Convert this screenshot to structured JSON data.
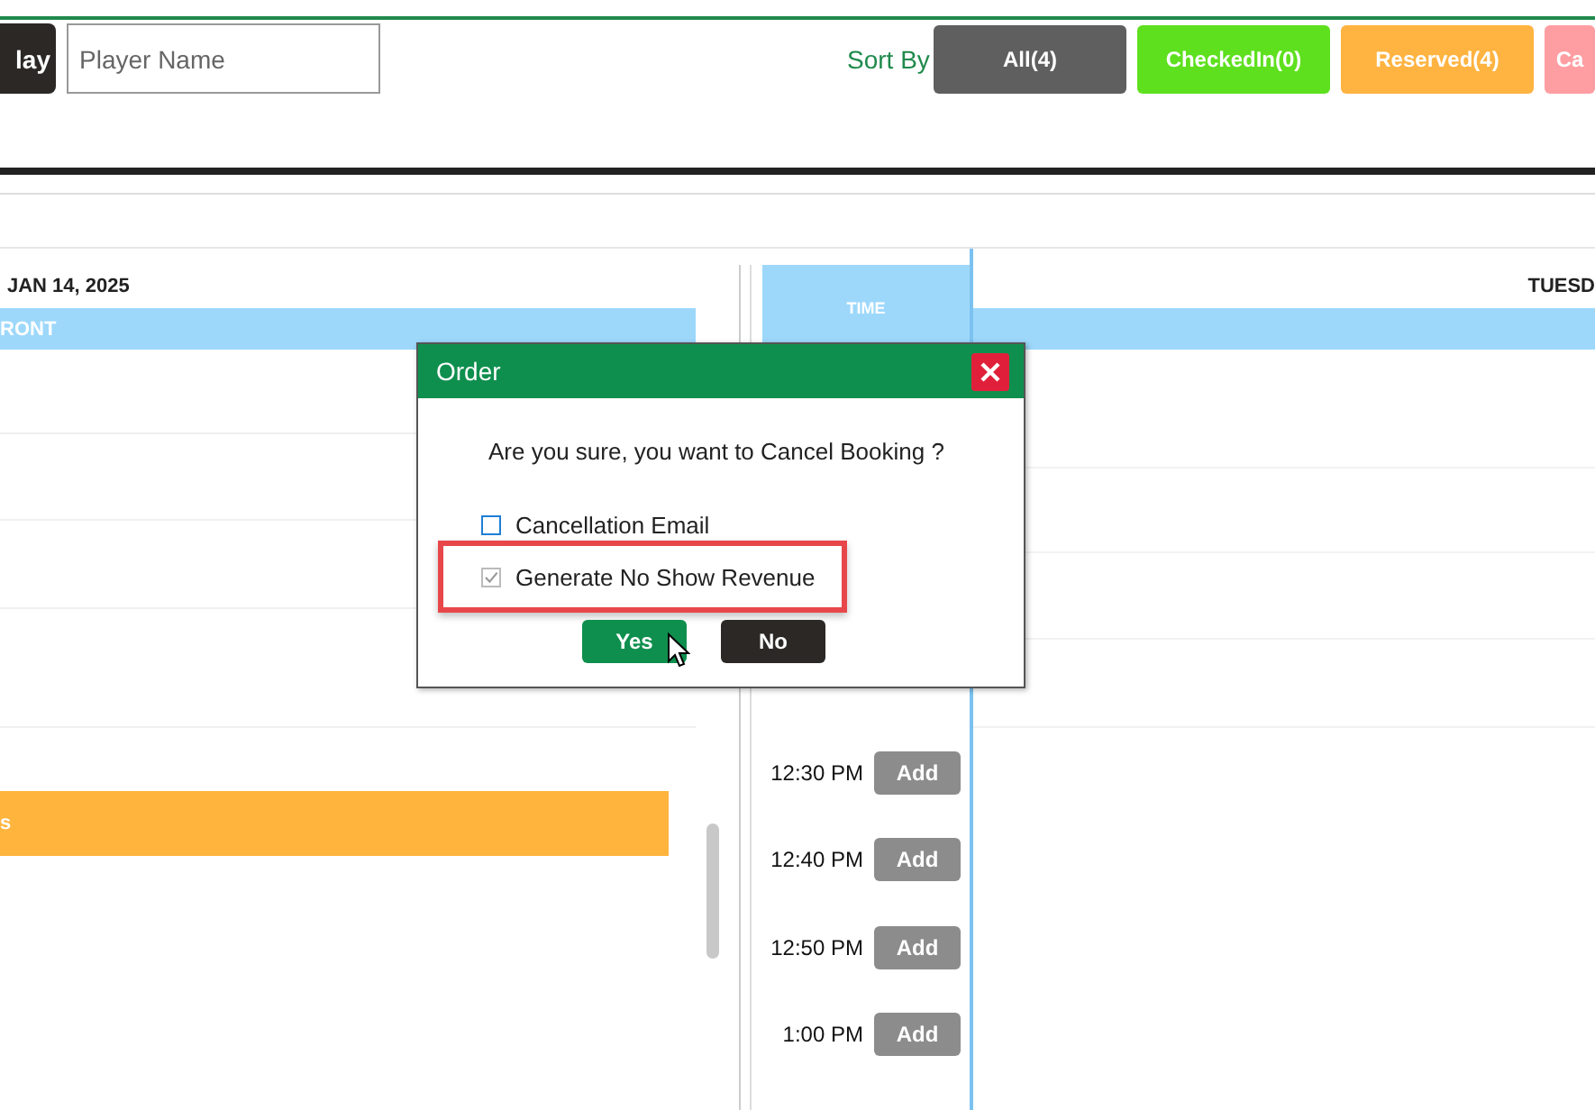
{
  "toolbar": {
    "day_button": "lay",
    "player_search": {
      "placeholder": "Player Name"
    },
    "sort_label": "Sort By",
    "filters": [
      {
        "label": "All(4)",
        "color": "#5f5f5f"
      },
      {
        "label": "CheckedIn(0)",
        "color": "#5ee01e"
      },
      {
        "label": "Reserved(4)",
        "color": "#ffb340"
      },
      {
        "label": "Ca",
        "color": "#ff9ea2"
      }
    ]
  },
  "left_day": {
    "date": "JAN 14, 2025",
    "lane": "RONT",
    "booking": {
      "label": "s"
    }
  },
  "right_day": {
    "time_header": "TIME",
    "date": "TUESD",
    "slots": [
      {
        "time": "12:30 PM",
        "action": "Add"
      },
      {
        "time": "12:40 PM",
        "action": "Add"
      },
      {
        "time": "12:50 PM",
        "action": "Add"
      },
      {
        "time": "1:00 PM",
        "action": "Add"
      }
    ]
  },
  "dialog": {
    "title": "Order",
    "message": "Are you sure, you want to Cancel Booking ?",
    "options": [
      {
        "label": "Cancellation Email",
        "checked": false,
        "highlighted": false
      },
      {
        "label": "Generate No Show Revenue",
        "checked": true,
        "highlighted": true
      }
    ],
    "buttons": [
      {
        "label": "Yes",
        "kind": "primary"
      },
      {
        "label": "No",
        "kind": "secondary"
      }
    ]
  }
}
